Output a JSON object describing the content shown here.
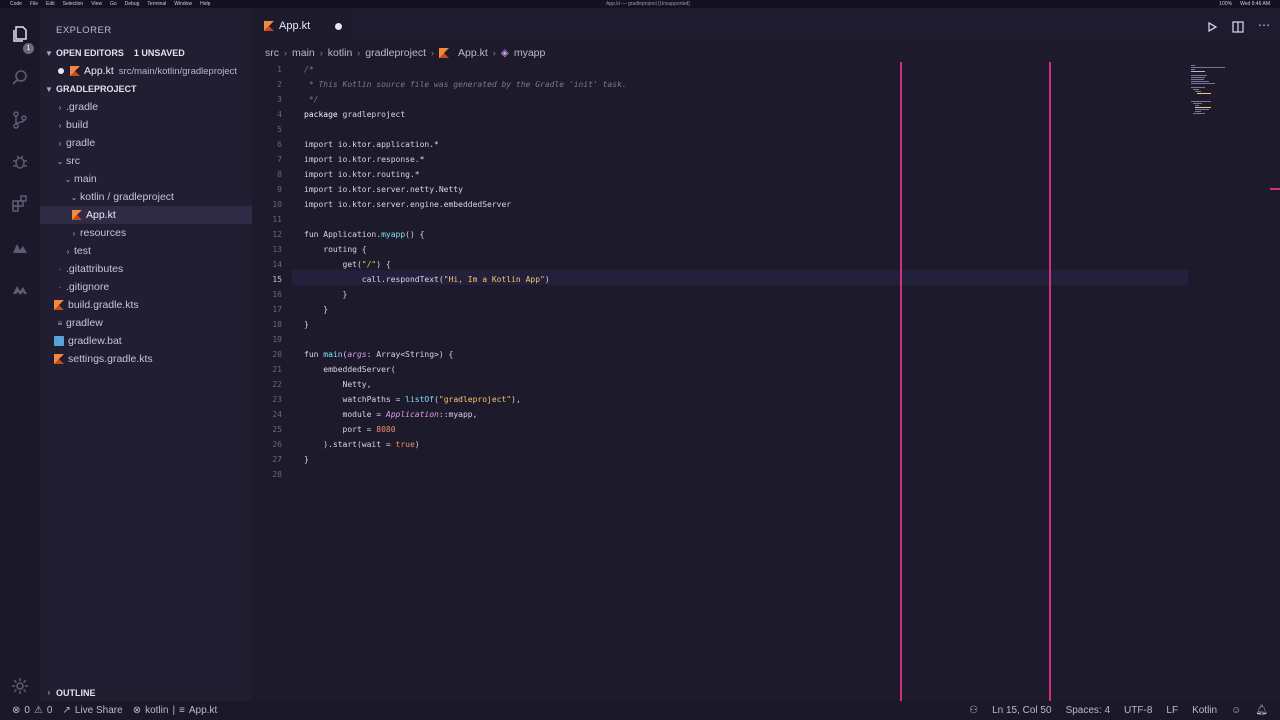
{
  "menubar": {
    "items": [
      "Code",
      "File",
      "Edit",
      "Selection",
      "View",
      "Go",
      "Debug",
      "Terminal",
      "Window",
      "Help"
    ],
    "title": "App.kt — gradleproject [Unsupported]",
    "right": [
      "100%",
      "Wed 9:46 AM"
    ]
  },
  "activity": {
    "badge": "1"
  },
  "sidebar": {
    "title": "EXPLORER",
    "open_editors": {
      "label": "OPEN EDITORS",
      "count": "1 UNSAVED",
      "file": "App.kt",
      "path": "src/main/kotlin/gradleproject"
    },
    "project": "GRADLEPROJECT",
    "tree": [
      ".gradle",
      "build",
      "gradle",
      "src",
      "main",
      "kotlin / gradleproject",
      "App.kt",
      "resources",
      "test",
      ".gitattributes",
      ".gitignore",
      "build.gradle.kts",
      "gradlew",
      "gradlew.bat",
      "settings.gradle.kts"
    ],
    "outline": "OUTLINE"
  },
  "tab": {
    "label": "App.kt"
  },
  "breadcrumbs": [
    "src",
    "main",
    "kotlin",
    "gradleproject",
    "App.kt",
    "myapp"
  ],
  "code": {
    "l1": "/*",
    "l2": " * This Kotlin source file was generated by the Gradle 'init' task.",
    "l3": " */",
    "l4_kw": "package",
    "l4_rest": " gradleproject",
    "l6": "import io.ktor.application.*",
    "l7": "import io.ktor.response.*",
    "l8": "import io.ktor.routing.*",
    "l9": "import io.ktor.server.netty.Netty",
    "l10": "import io.ktor.server.engine.embeddedServer",
    "l12_a": "fun Application.",
    "l12_fn": "myapp",
    "l12_b": "() {",
    "l13": "    routing {",
    "l14_a": "        get(",
    "l14_s": "\"/\"",
    "l14_b": ") {",
    "l15_a": "            call.respondText(",
    "l15_s": "\"Hi, Im a Kotlin App\"",
    "l15_b": ")",
    "l16": "        }",
    "l17": "    }",
    "l18": "}",
    "l20_a": "fun ",
    "l20_fn": "main",
    "l20_b": "(",
    "l20_arg": "args",
    "l20_c": ": Array<String>) {",
    "l21": "    embeddedServer(",
    "l22": "        Netty,",
    "l23_a": "        watchPaths = ",
    "l23_fn": "listOf",
    "l23_b": "(",
    "l23_s": "\"gradleproject\"",
    "l23_c": "),",
    "l24_a": "        module = ",
    "l24_cls": "Application",
    "l24_b": "::myapp,",
    "l25_a": "        port = ",
    "l25_num": "8080",
    "l26_a": "    ).start(wait = ",
    "l26_kw": "true",
    "l26_b": ")",
    "l27": "}"
  },
  "status": {
    "errors": "0",
    "warnings": "0",
    "live_share": "Live Share",
    "crumb1": "kotlin",
    "crumb2": "App.kt",
    "position": "Ln 15, Col 50",
    "spaces": "Spaces: 4",
    "encoding": "UTF-8",
    "eol": "LF",
    "language": "Kotlin"
  }
}
